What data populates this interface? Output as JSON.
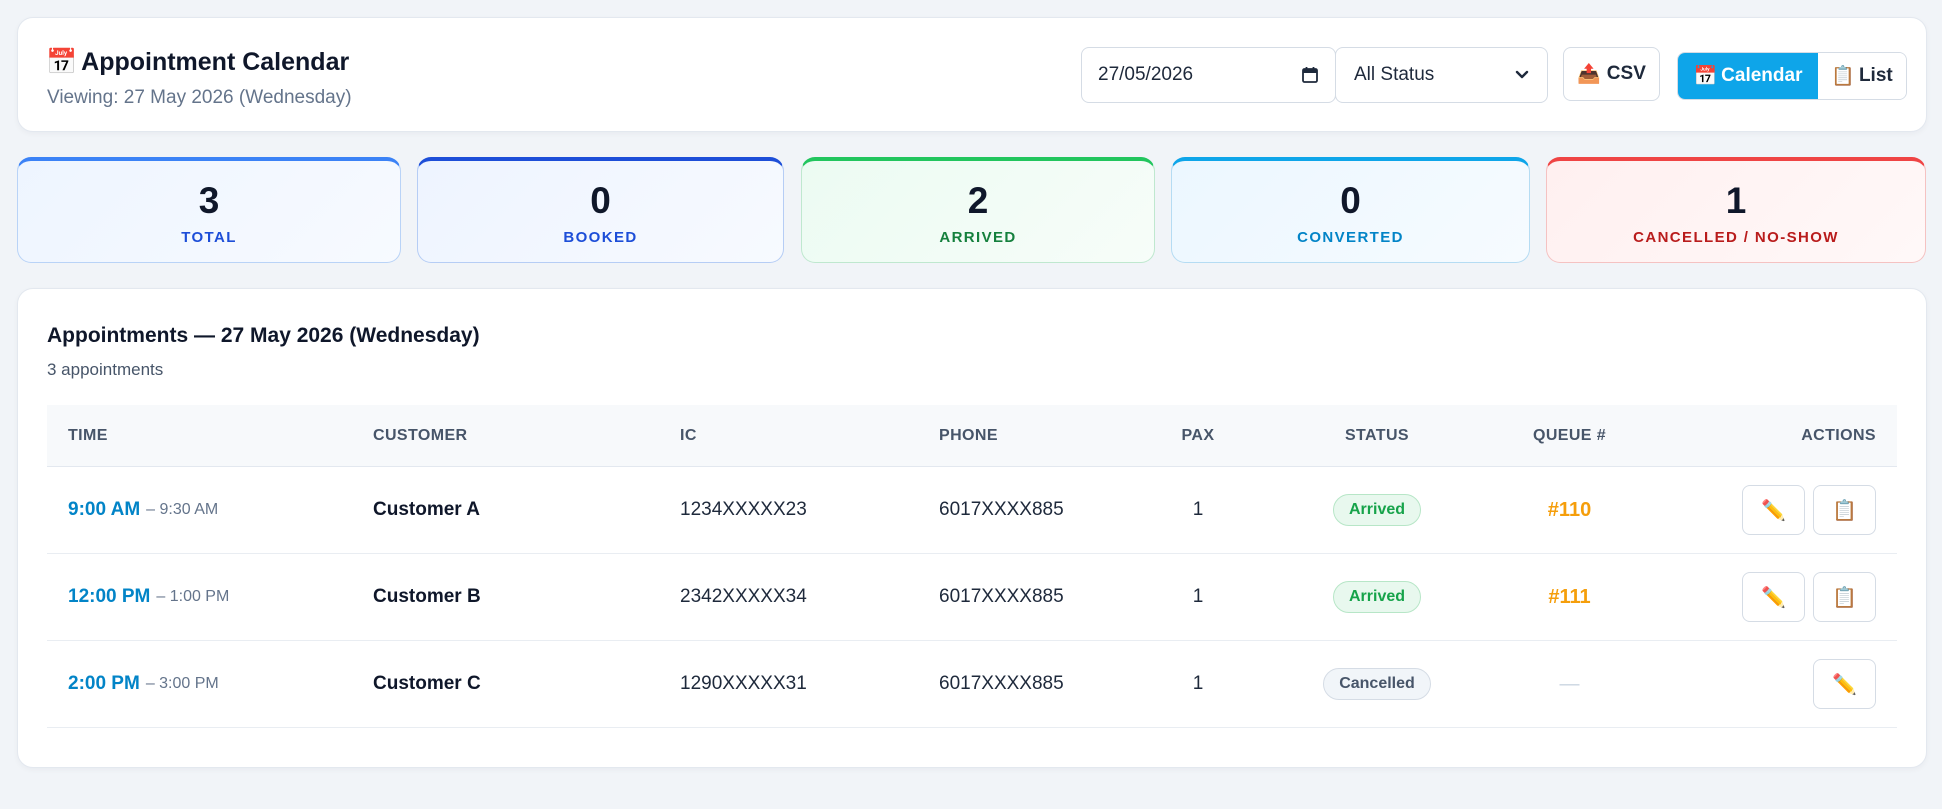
{
  "header": {
    "icon": "📅",
    "title": "Appointment Calendar",
    "viewing_prefix": "Viewing: ",
    "viewing_value": "27 May 2026 (Wednesday)",
    "date_value": "27/05/2026",
    "status_filter": "All Status",
    "csv_icon": "📤",
    "csv_label": "CSV",
    "calendar_icon": "📅",
    "calendar_label": "Calendar",
    "list_icon": "📋",
    "list_label": "List"
  },
  "stats": {
    "total": {
      "value": "3",
      "label": "TOTAL"
    },
    "booked": {
      "value": "0",
      "label": "BOOKED"
    },
    "arrived": {
      "value": "2",
      "label": "ARRIVED"
    },
    "converted": {
      "value": "0",
      "label": "CONVERTED"
    },
    "cancelled": {
      "value": "1",
      "label": "CANCELLED / NO-SHOW"
    }
  },
  "appointments": {
    "title": "Appointments — 27 May 2026 (Wednesday)",
    "count": "3 appointments",
    "columns": {
      "time": "TIME",
      "customer": "CUSTOMER",
      "ic": "IC",
      "phone": "PHONE",
      "pax": "PAX",
      "status": "STATUS",
      "queue": "QUEUE #",
      "actions": "ACTIONS"
    },
    "rows": [
      {
        "start": "9:00 AM",
        "end": "– 9:30 AM",
        "customer": "Customer A",
        "ic": "1234XXXXX23",
        "phone": "6017XXXX885",
        "pax": "1",
        "status": "Arrived",
        "queue": "#110"
      },
      {
        "start": "12:00 PM",
        "end": "– 1:00 PM",
        "customer": "Customer B",
        "ic": "2342XXXXX34",
        "phone": "6017XXXX885",
        "pax": "1",
        "status": "Arrived",
        "queue": "#111"
      },
      {
        "start": "2:00 PM",
        "end": "– 3:00 PM",
        "customer": "Customer C",
        "ic": "1290XXXXX31",
        "phone": "6017XXXX885",
        "pax": "1",
        "status": "Cancelled",
        "queue": "—"
      }
    ],
    "edit_icon": "✏️",
    "notes_icon": "📋"
  },
  "colors": {
    "accent": "#0ea5e9",
    "queue": "#f59e0b",
    "arrived": "#16a34a",
    "cancelled": "#ef4444"
  }
}
